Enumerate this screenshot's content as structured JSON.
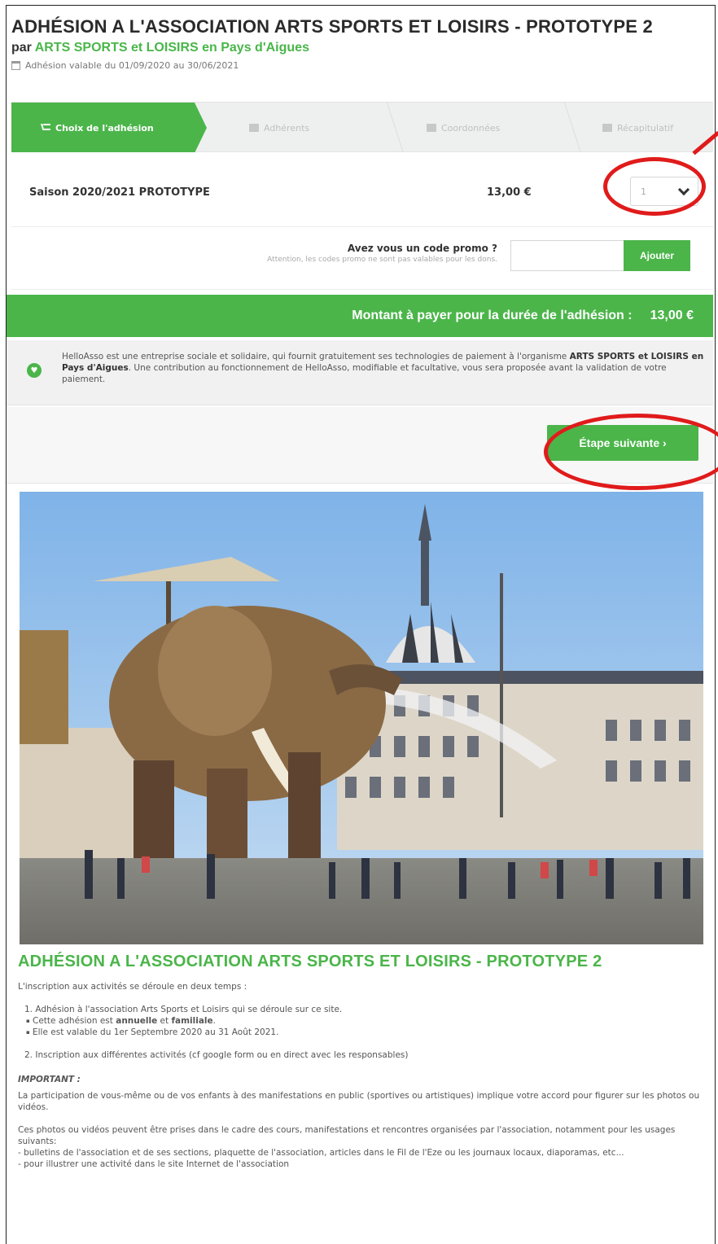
{
  "header": {
    "title": "ADHÉSION A L'ASSOCIATION ARTS SPORTS ET LOISIRS - PROTOTYPE 2",
    "by_prefix": "par ",
    "organization": "ARTS SPORTS et LOISIRS en Pays d'Aigues",
    "validity": "Adhésion valable du 01/09/2020 au 30/06/2021"
  },
  "steps": [
    {
      "label": "Choix de l'adhésion",
      "icon": "cart-icon",
      "active": true
    },
    {
      "label": "Adhérents",
      "icon": "users-icon",
      "active": false
    },
    {
      "label": "Coordonnées",
      "icon": "list-icon",
      "active": false
    },
    {
      "label": "Récapitulatif",
      "icon": "check-icon",
      "active": false
    }
  ],
  "membership": {
    "name": "Saison 2020/2021 PROTOTYPE",
    "price": "13,00 €",
    "quantity": "1"
  },
  "promo": {
    "question": "Avez vous un code promo ?",
    "warning": "Attention, les codes promo ne sont pas valables pour les dons.",
    "placeholder": "",
    "button": "Ajouter"
  },
  "amount": {
    "label": "Montant à payer pour la durée de l'adhésion :",
    "value": "13,00 €"
  },
  "info": {
    "text_1": "HelloAsso est une entreprise sociale et solidaire, qui fournit gratuitement ses technologies de paiement à l'organisme ",
    "org": "ARTS SPORTS et LOISIRS en Pays d'Aigues",
    "text_2": ". Une contribution au fonctionnement de HelloAsso, modifiable et facultative, vous sera proposée avant la validation de votre paiement."
  },
  "next_button": "Étape suivante ›",
  "article": {
    "title": "ADHÉSION A L'ASSOCIATION ARTS SPORTS ET LOISIRS - PROTOTYPE 2",
    "intro": "L'inscription aux activités se déroule en deux temps :",
    "item1": "1. Adhésion à l'association Arts Sports et Loisirs qui se déroule sur ce site.",
    "bullet1_pre": "Cette adhésion est ",
    "bullet1_b1": "annuelle",
    "bullet1_mid": " et ",
    "bullet1_b2": "familiale",
    "bullet1_post": ".",
    "bullet2": "Elle est valable du 1er Septembre 2020 au 31 Août 2021.",
    "item2": "2. Inscription aux différentes activités (cf google form ou en direct avec les responsables)",
    "important": "IMPORTANT :",
    "para1": " La participation de vous-même ou de vos enfants à des manifestations en public (sportives ou artistiques) implique votre accord pour figurer sur les photos ou vidéos.",
    "para2": "Ces photos ou vidéos peuvent être prises dans le cadre des cours, manifestations et rencontres organisées par l'association, notamment pour les usages suivants:",
    "usage1": "  - bulletins de l'association et de ses sections, plaquette de l'association, articles dans le Fil de l'Eze ou les journaux locaux, diaporamas, etc...",
    "usage2": "  - pour illustrer une activité dans le site Internet de l'association"
  },
  "colors": {
    "accent": "#4bb54a",
    "annotation": "#e01b1b"
  }
}
